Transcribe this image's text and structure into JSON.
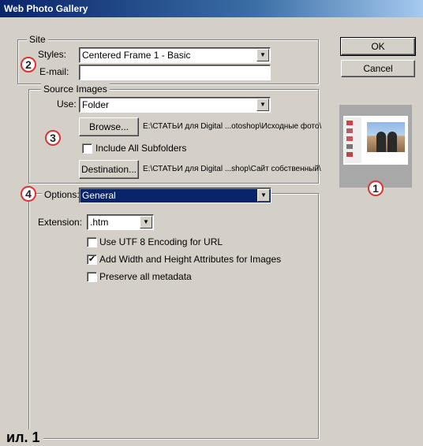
{
  "window": {
    "title": "Web Photo Gallery"
  },
  "site": {
    "legend": "Site",
    "styles_label": "Styles:",
    "styles_value": "Centered Frame 1 - Basic",
    "email_label": "E-mail:",
    "email_value": ""
  },
  "source": {
    "legend": "Source Images",
    "use_label": "Use:",
    "use_value": "Folder",
    "browse_label": "Browse...",
    "browse_path": "E:\\СТАТЬИ для Digital ...otoshop\\Исходные фото\\",
    "include_subfolders_label": "Include All Subfolders",
    "include_subfolders_checked": false,
    "destination_label": "Destination...",
    "destination_path": "E:\\СТАТЬИ для Digital ...shop\\Сайт собственный\\"
  },
  "options": {
    "label": "Options:",
    "value": "General",
    "extension_label": "Extension:",
    "extension_value": ".htm",
    "checkboxes": [
      {
        "label": "Use UTF 8 Encoding for URL",
        "checked": false
      },
      {
        "label": "Add Width and Height Attributes for Images",
        "checked": true
      },
      {
        "label": "Preserve all metadata",
        "checked": false
      }
    ]
  },
  "buttons": {
    "ok": "OK",
    "cancel": "Cancel"
  },
  "markers": {
    "m1": "1",
    "m2": "2",
    "m3": "3",
    "m4": "4"
  },
  "caption": "ил. 1",
  "icons": {
    "dropdown": "chevron-down-icon",
    "check": "check-icon"
  },
  "colors": {
    "titlebar": "#0a246a",
    "selection": "#0a246a",
    "marker": "#dd3333",
    "dialog": "#d4d0c8"
  }
}
